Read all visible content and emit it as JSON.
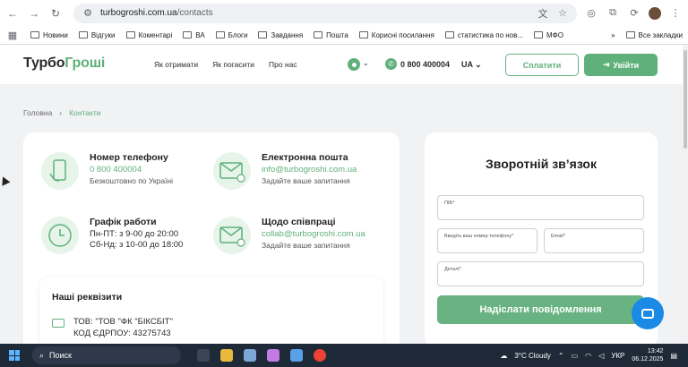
{
  "browser": {
    "url_host": "turbogroshi.com.ua",
    "url_path": "/contacts",
    "bookmarks": [
      "Новини",
      "Відгуки",
      "Коментарі",
      "ВА",
      "Блоги",
      "Завдання",
      "Пошта",
      "Корисні посилання",
      "статистика по нов...",
      "МФО"
    ],
    "all_bookmarks": "Все закладки"
  },
  "header": {
    "logo_part1": "Турбо",
    "logo_part2": "Гроші",
    "nav": [
      "Як отримати",
      "Як погасити",
      "Про нас"
    ],
    "phone": "0 800 400004",
    "lang": "UA",
    "pay_label": "Сплатити",
    "login_label": "Увійти"
  },
  "breadcrumb": {
    "home": "Головна",
    "current": "Контакти"
  },
  "contacts": {
    "phone": {
      "title": "Номер телефону",
      "link": "0 800 400004",
      "sub": "Безкоштовно по Україні"
    },
    "email": {
      "title": "Електронна пошта",
      "link": "info@turbogroshi.com.ua",
      "sub": "Задайте ваше запитання"
    },
    "schedule": {
      "title": "Графік работи",
      "line1": "Пн-ПТ: з 9-00 до 20:00",
      "line2": "Сб-Нд: з 10-00 до 18:00"
    },
    "partners": {
      "title": "Щодо співпраці",
      "link": "collab@turbogroshi.com.ua",
      "sub": "Задайте ваше запитання"
    }
  },
  "requisites": {
    "title": "Наші реквізити",
    "line1": "ТОВ: \"ТОВ \"ФК \"БІКСБІТ\"",
    "line2": "КОД ЄДРПОУ: 43275743"
  },
  "form": {
    "title": "Зворотній зв’язок",
    "name_ph": "ПІБ*",
    "phone_ph": "Введіть ваш номер телефону*",
    "email_ph": "Email*",
    "details_ph": "Деталі*",
    "submit_label": "Надіслати повідомлення"
  },
  "taskbar": {
    "search_label": "Поиск",
    "weather": "3°C  Cloudy",
    "lang": "УКР",
    "time": "13:42",
    "date": "06.12.2025"
  },
  "colors": {
    "brand_green": "#5fb07a",
    "chat_blue": "#1a8ae6"
  }
}
